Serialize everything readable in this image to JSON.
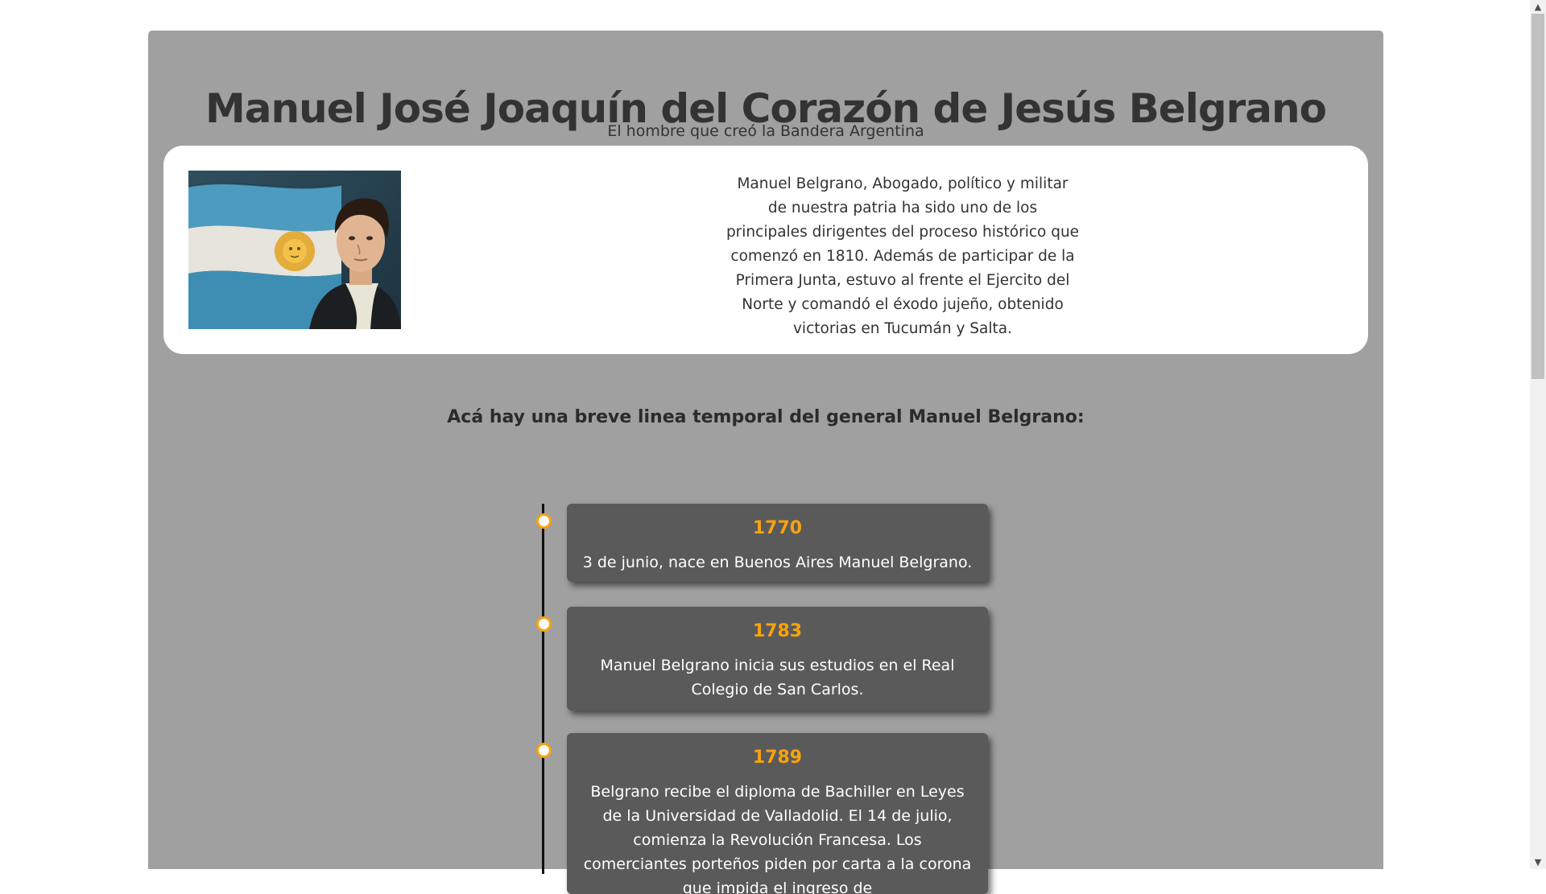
{
  "header": {
    "title": "Manuel José Joaquín del Corazón de Jesús Belgrano",
    "subtitle": "El hombre que creó la Bandera Argentina"
  },
  "bio": {
    "portrait_alt": "Retrato de Manuel Belgrano con la Bandera Argentina",
    "text": "Manuel Belgrano, Abogado, político y militar de nuestra patria ha sido uno de los principales dirigentes del proceso histórico que comenzó en 1810. Además de participar de la Primera Junta, estuvo al frente el Ejercito del Norte y comandó el éxodo jujeño, obtenido victorias en Tucumán y Salta."
  },
  "timeline": {
    "heading": "Acá hay una breve linea temporal del general Manuel Belgrano:",
    "events": [
      {
        "year": "1770",
        "text": "3 de junio, nace en Buenos Aires Manuel Belgrano."
      },
      {
        "year": "1783",
        "text": "Manuel Belgrano inicia sus estudios en el Real Colegio de San Carlos."
      },
      {
        "year": "1789",
        "text": "Belgrano recibe el diploma de Bachiller en Leyes de la Universidad de Valladolid. El 14 de julio, comienza la Revolución Francesa. Los comerciantes porteños piden por carta a la corona que impida el ingreso de"
      }
    ]
  },
  "colors": {
    "page_bg": "#ffffff",
    "container_bg": "#a0a0a0",
    "card_bg": "#5a5a5a",
    "accent": "#f7a30f",
    "title_text": "#333333"
  },
  "icons": {
    "scroll_up": "▲",
    "scroll_down": "▼"
  }
}
